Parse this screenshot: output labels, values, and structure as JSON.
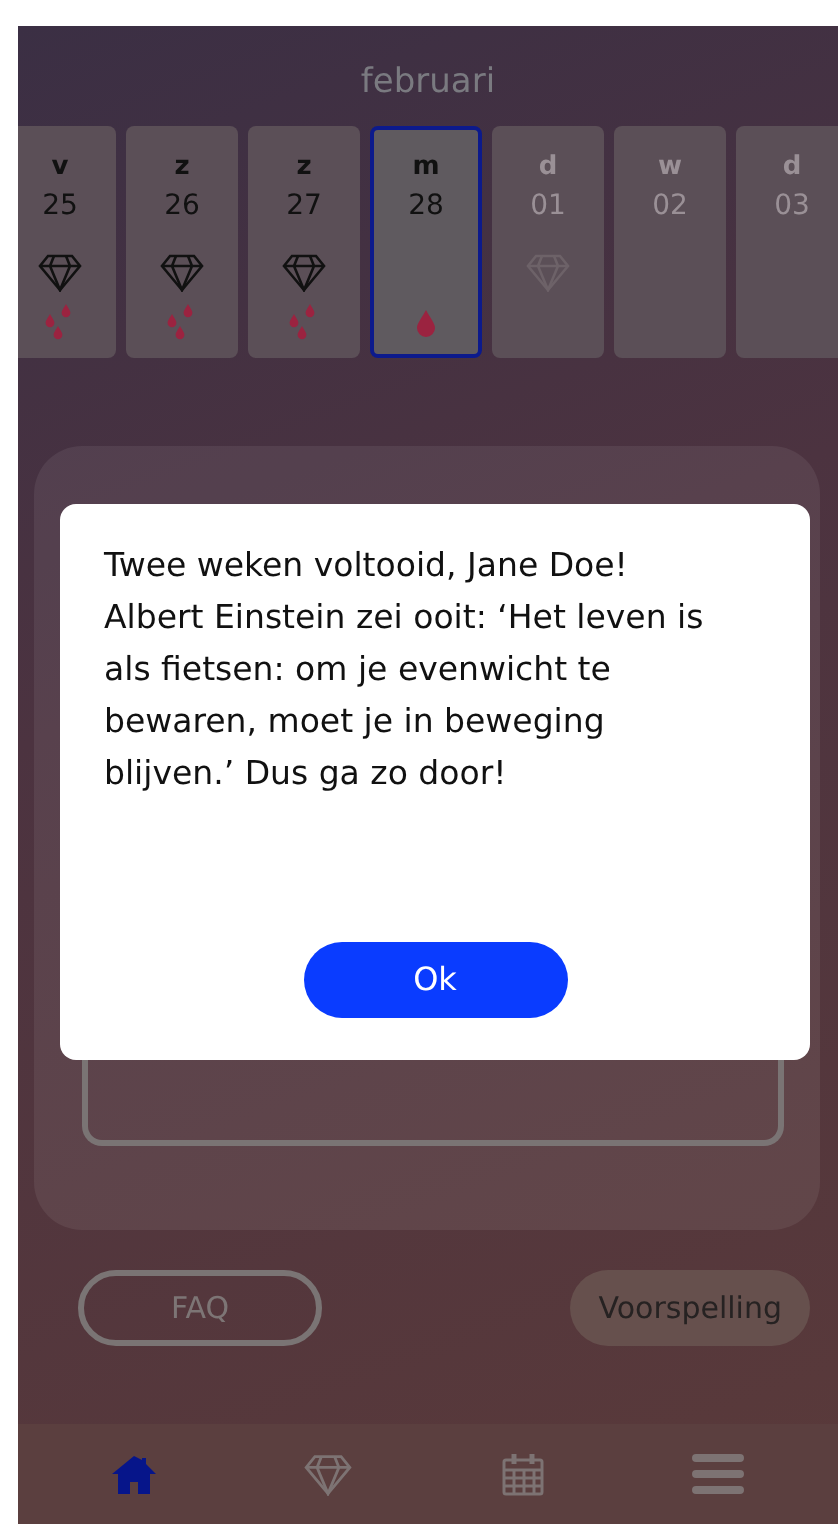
{
  "month": "februari",
  "days": [
    {
      "weekday": "v",
      "date": "25",
      "selected": false,
      "future": false,
      "diamond": true,
      "kind": "drops"
    },
    {
      "weekday": "z",
      "date": "26",
      "selected": false,
      "future": false,
      "diamond": true,
      "kind": "drops"
    },
    {
      "weekday": "z",
      "date": "27",
      "selected": false,
      "future": false,
      "diamond": true,
      "kind": "drops"
    },
    {
      "weekday": "m",
      "date": "28",
      "selected": true,
      "future": false,
      "diamond": false,
      "kind": "drop"
    },
    {
      "weekday": "d",
      "date": "01",
      "selected": false,
      "future": true,
      "diamond": true,
      "kind": "plain"
    },
    {
      "weekday": "w",
      "date": "02",
      "selected": false,
      "future": true,
      "diamond": false,
      "kind": "plain"
    },
    {
      "weekday": "d",
      "date": "03",
      "selected": false,
      "future": true,
      "diamond": false,
      "kind": "plain"
    }
  ],
  "actions": [
    {
      "label": "FAQ",
      "kind": "outline"
    },
    {
      "label": "Voorspelling",
      "kind": "filled"
    }
  ],
  "nav": [
    {
      "kind": "home",
      "selected": true
    },
    {
      "kind": "diamond",
      "selected": false
    },
    {
      "kind": "calendar",
      "selected": false
    },
    {
      "kind": "menu",
      "selected": false
    }
  ],
  "dialog": {
    "message": "Twee weken voltooid, Jane Doe! Albert Einstein zei ooit: ‘Het leven is als fietsen: om je evenwicht te bewaren, moet je in beweging blijven.’ Dus ga zo door!",
    "button": "Ok"
  }
}
